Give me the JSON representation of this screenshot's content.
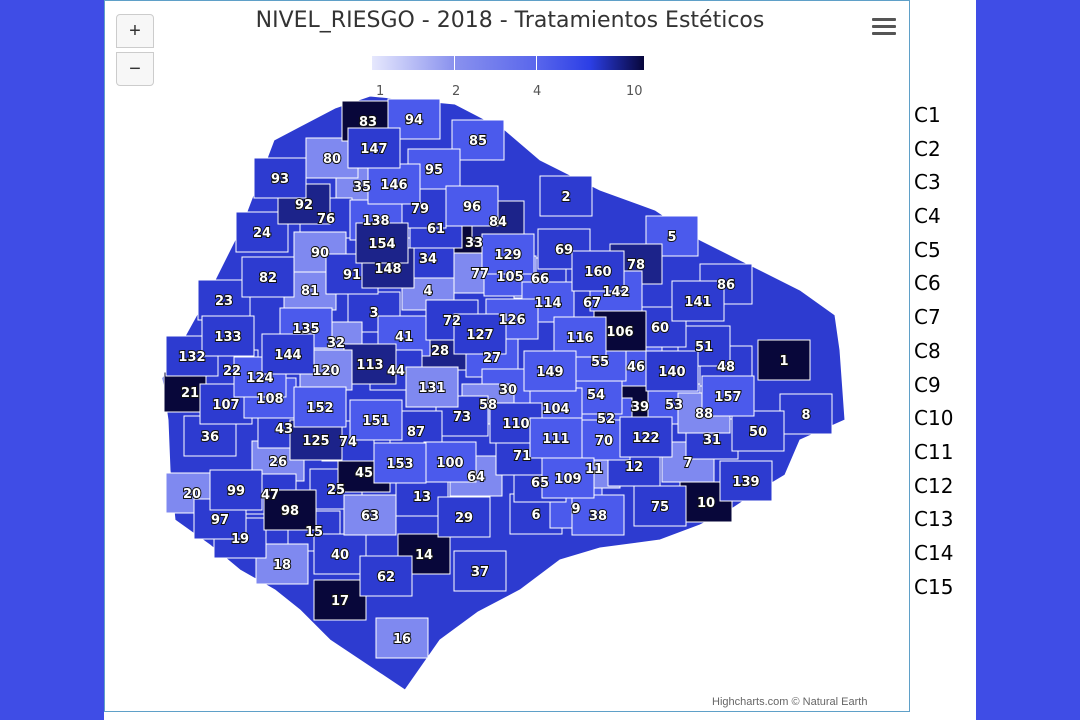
{
  "title": "NIVEL_RIESGO - 2018 - Tratamientos Estéticos",
  "zoom": {
    "in_label": "+",
    "out_label": "−"
  },
  "color_axis": {
    "labels": [
      "1",
      "2",
      "4",
      "10"
    ],
    "stops": [
      "#e6e8fd",
      "#8a92ee",
      "#5a67ec",
      "#2c3fe6",
      "#07063a"
    ]
  },
  "credits": "Highcharts.com © Natural Earth",
  "legend": [
    "C1",
    "C2",
    "C3",
    "C4",
    "C5",
    "C6",
    "C7",
    "C8",
    "C9",
    "C10",
    "C11",
    "C12",
    "C13",
    "C14",
    "C15"
  ],
  "regions": [
    {
      "id": "1",
      "value": 10
    },
    {
      "id": "2",
      "value": 5
    },
    {
      "id": "3",
      "value": 5
    },
    {
      "id": "4",
      "value": 2
    },
    {
      "id": "5",
      "value": 4
    },
    {
      "id": "6",
      "value": 5
    },
    {
      "id": "7",
      "value": 2
    },
    {
      "id": "8",
      "value": 5
    },
    {
      "id": "9",
      "value": 3
    },
    {
      "id": "10",
      "value": 10
    },
    {
      "id": "11",
      "value": 2
    },
    {
      "id": "12",
      "value": 5
    },
    {
      "id": "13",
      "value": 5
    },
    {
      "id": "14",
      "value": 10
    },
    {
      "id": "15",
      "value": 5
    },
    {
      "id": "16",
      "value": 2
    },
    {
      "id": "17",
      "value": 10
    },
    {
      "id": "18",
      "value": 2
    },
    {
      "id": "19",
      "value": 5
    },
    {
      "id": "20",
      "value": 2
    },
    {
      "id": "21",
      "value": 10
    },
    {
      "id": "22",
      "value": 5
    },
    {
      "id": "23",
      "value": 5
    },
    {
      "id": "24",
      "value": 5
    },
    {
      "id": "25",
      "value": 5
    },
    {
      "id": "26",
      "value": 2
    },
    {
      "id": "27",
      "value": 3
    },
    {
      "id": "28",
      "value": 6
    },
    {
      "id": "29",
      "value": 5
    },
    {
      "id": "30",
      "value": 3
    },
    {
      "id": "31",
      "value": 5
    },
    {
      "id": "32",
      "value": 2
    },
    {
      "id": "33",
      "value": 10
    },
    {
      "id": "34",
      "value": 5
    },
    {
      "id": "35",
      "value": 2
    },
    {
      "id": "36",
      "value": 5
    },
    {
      "id": "37",
      "value": 5
    },
    {
      "id": "38",
      "value": 3
    },
    {
      "id": "39",
      "value": 10
    },
    {
      "id": "40",
      "value": 5
    },
    {
      "id": "41",
      "value": 3
    },
    {
      "id": "43",
      "value": 5
    },
    {
      "id": "44",
      "value": 5
    },
    {
      "id": "45",
      "value": 10
    },
    {
      "id": "46",
      "value": 3
    },
    {
      "id": "47",
      "value": 5
    },
    {
      "id": "48",
      "value": 5
    },
    {
      "id": "50",
      "value": 5
    },
    {
      "id": "51",
      "value": 5
    },
    {
      "id": "52",
      "value": 3
    },
    {
      "id": "53",
      "value": 3
    },
    {
      "id": "54",
      "value": 3
    },
    {
      "id": "55",
      "value": 3
    },
    {
      "id": "58",
      "value": 2
    },
    {
      "id": "60",
      "value": 5
    },
    {
      "id": "61",
      "value": 5
    },
    {
      "id": "62",
      "value": 5
    },
    {
      "id": "63",
      "value": 2
    },
    {
      "id": "64",
      "value": 2
    },
    {
      "id": "65",
      "value": 5
    },
    {
      "id": "66",
      "value": 5
    },
    {
      "id": "67",
      "value": 5
    },
    {
      "id": "69",
      "value": 5
    },
    {
      "id": "70",
      "value": 3
    },
    {
      "id": "71",
      "value": 5
    },
    {
      "id": "72",
      "value": 5
    },
    {
      "id": "73",
      "value": 5
    },
    {
      "id": "74",
      "value": 5
    },
    {
      "id": "75",
      "value": 5
    },
    {
      "id": "76",
      "value": 5
    },
    {
      "id": "77",
      "value": 2
    },
    {
      "id": "78",
      "value": 6
    },
    {
      "id": "79",
      "value": 5
    },
    {
      "id": "80",
      "value": 2
    },
    {
      "id": "81",
      "value": 2
    },
    {
      "id": "82",
      "value": 5
    },
    {
      "id": "83",
      "value": 10
    },
    {
      "id": "84",
      "value": 6
    },
    {
      "id": "85",
      "value": 3
    },
    {
      "id": "86",
      "value": 5
    },
    {
      "id": "87",
      "value": 5
    },
    {
      "id": "88",
      "value": 2
    },
    {
      "id": "90",
      "value": 2
    },
    {
      "id": "91",
      "value": 5
    },
    {
      "id": "92",
      "value": 6
    },
    {
      "id": "93",
      "value": 5
    },
    {
      "id": "94",
      "value": 3
    },
    {
      "id": "95",
      "value": 3
    },
    {
      "id": "96",
      "value": 3
    },
    {
      "id": "97",
      "value": 5
    },
    {
      "id": "98",
      "value": 10
    },
    {
      "id": "99",
      "value": 5
    },
    {
      "id": "100",
      "value": 3
    },
    {
      "id": "104",
      "value": 3
    },
    {
      "id": "105",
      "value": 3
    },
    {
      "id": "106",
      "value": 10
    },
    {
      "id": "107",
      "value": 5
    },
    {
      "id": "108",
      "value": 3
    },
    {
      "id": "109",
      "value": 3
    },
    {
      "id": "110",
      "value": 5
    },
    {
      "id": "111",
      "value": 3
    },
    {
      "id": "113",
      "value": 6
    },
    {
      "id": "114",
      "value": 3
    },
    {
      "id": "116",
      "value": 3
    },
    {
      "id": "120",
      "value": 2
    },
    {
      "id": "122",
      "value": 5
    },
    {
      "id": "124",
      "value": 3
    },
    {
      "id": "125",
      "value": 6
    },
    {
      "id": "126",
      "value": 3
    },
    {
      "id": "127",
      "value": 5
    },
    {
      "id": "129",
      "value": 3
    },
    {
      "id": "131",
      "value": 2
    },
    {
      "id": "132",
      "value": 5
    },
    {
      "id": "133",
      "value": 5
    },
    {
      "id": "135",
      "value": 3
    },
    {
      "id": "138",
      "value": 3
    },
    {
      "id": "139",
      "value": 5
    },
    {
      "id": "140",
      "value": 5
    },
    {
      "id": "141",
      "value": 5
    },
    {
      "id": "142",
      "value": 3
    },
    {
      "id": "144",
      "value": 5
    },
    {
      "id": "146",
      "value": 3
    },
    {
      "id": "147",
      "value": 5
    },
    {
      "id": "148",
      "value": 6
    },
    {
      "id": "149",
      "value": 3
    },
    {
      "id": "151",
      "value": 3
    },
    {
      "id": "152",
      "value": 3
    },
    {
      "id": "153",
      "value": 3
    },
    {
      "id": "154",
      "value": 6
    },
    {
      "id": "157",
      "value": 3
    },
    {
      "id": "160",
      "value": 5
    }
  ]
}
